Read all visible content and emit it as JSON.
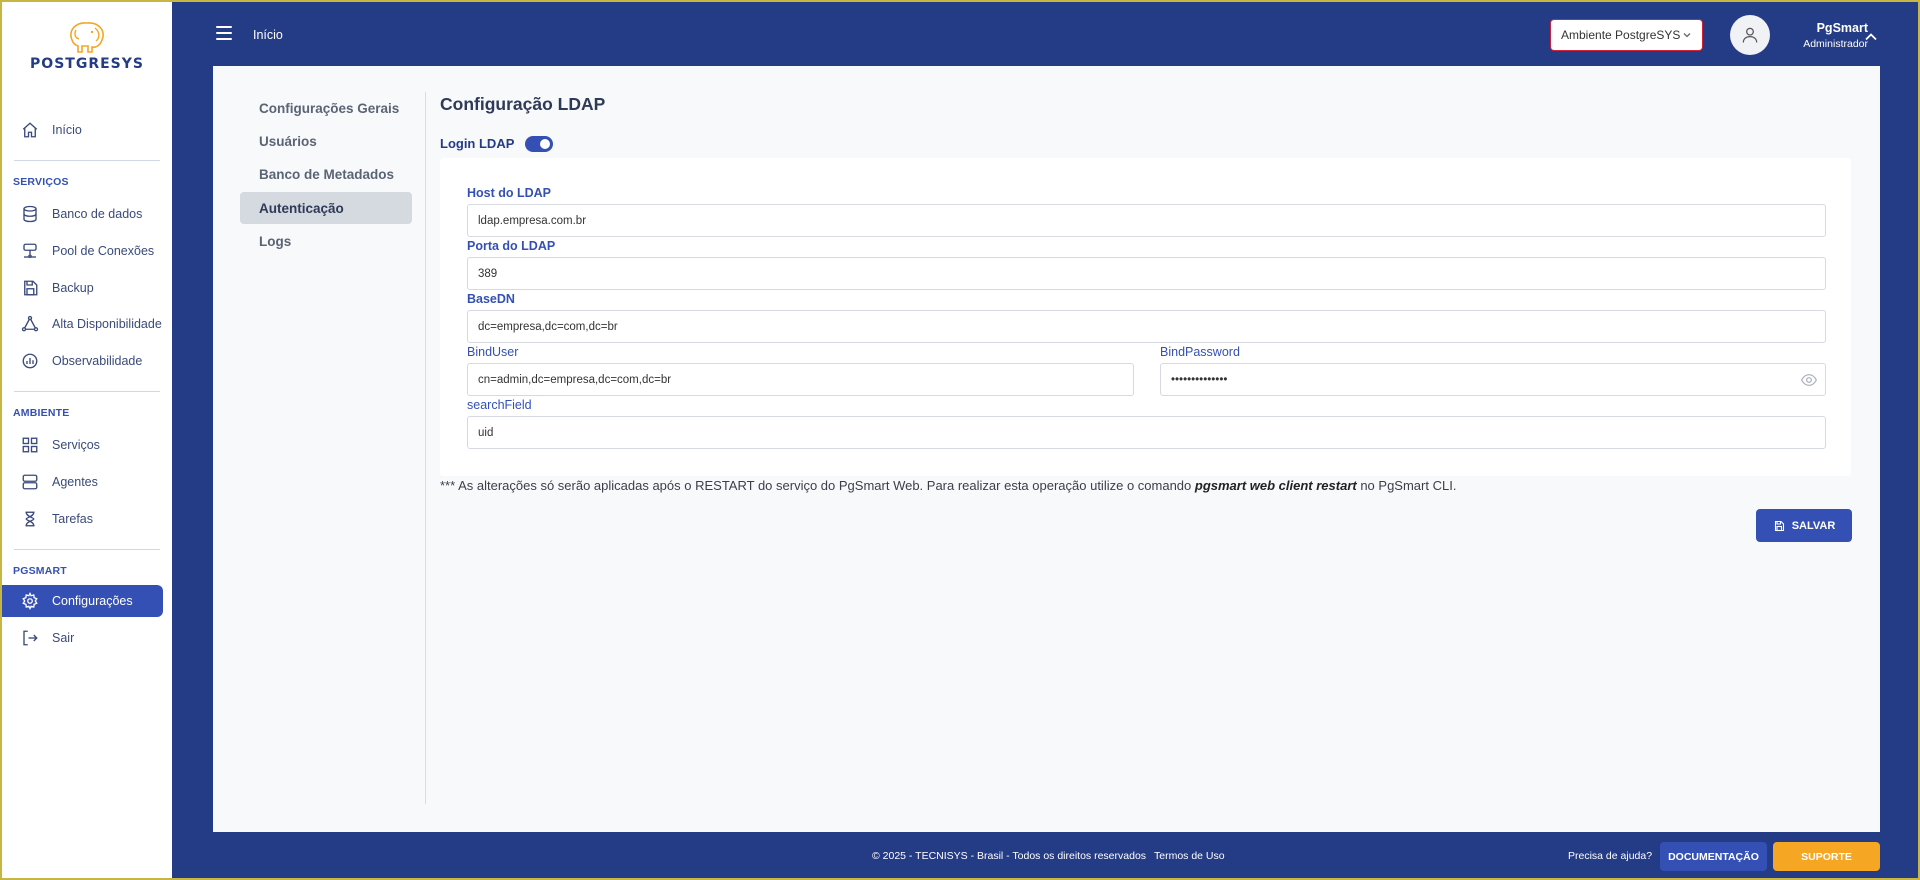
{
  "brand": {
    "name": "POSTGRESYS"
  },
  "sidebar": {
    "home": {
      "label": "Início",
      "icon": "home-icon"
    },
    "sections": [
      {
        "title": "SERVIÇOS"
      },
      {
        "title": "AMBIENTE"
      },
      {
        "title": "PGSMART"
      }
    ],
    "services": [
      {
        "label": "Banco de dados",
        "icon": "database-icon"
      },
      {
        "label": "Pool de Conexões",
        "icon": "connection-pool-icon"
      },
      {
        "label": "Backup",
        "icon": "save-icon"
      },
      {
        "label": "Alta Disponibilidade",
        "icon": "triangle-network-icon"
      },
      {
        "label": "Observabilidade",
        "icon": "chart-circle-icon"
      }
    ],
    "environment": [
      {
        "label": "Serviços",
        "icon": "grid-icon"
      },
      {
        "label": "Agentes",
        "icon": "server-icon"
      },
      {
        "label": "Tarefas",
        "icon": "hourglass-icon"
      }
    ],
    "pgsmart": [
      {
        "label": "Configurações",
        "icon": "gear-icon",
        "active": true
      },
      {
        "label": "Sair",
        "icon": "logout-icon"
      }
    ]
  },
  "topbar": {
    "breadcrumb": "Início",
    "environment_select": "Ambiente PostgreSYS",
    "user": {
      "name": "PgSmart",
      "role": "Administrador"
    }
  },
  "settings_nav": [
    {
      "label": "Configurações Gerais"
    },
    {
      "label": "Usuários"
    },
    {
      "label": "Banco de Metadados"
    },
    {
      "label": "Autenticação",
      "active": true
    },
    {
      "label": "Logs"
    }
  ],
  "ldap": {
    "title": "Configuração LDAP",
    "login_label": "Login LDAP",
    "login_enabled": true,
    "host_label": "Host do LDAP",
    "host_value": "ldap.empresa.com.br",
    "port_label": "Porta do LDAP",
    "port_value": "389",
    "basedn_label": "BaseDN",
    "basedn_value": "dc=empresa,dc=com,dc=br",
    "binduser_label": "BindUser",
    "binduser_value": "cn=admin,dc=empresa,dc=com,dc=br",
    "bindpassword_label": "BindPassword",
    "bindpassword_value": "••••••••••••••",
    "searchfield_label": "searchField",
    "searchfield_value": "uid",
    "notice_prefix": "*** As alterações só serão aplicadas após o RESTART do serviço do PgSmart Web. Para realizar esta operação utilize o comando ",
    "notice_command": "pgsmart web client restart",
    "notice_suffix": " no PgSmart CLI.",
    "save_label": "SALVAR"
  },
  "footer": {
    "copyright": "© 2025 - TECNISYS - Brasil - Todos os direitos reservados",
    "terms": "Termos de Uso",
    "help": "Precisa de ajuda?",
    "docs_button": "DOCUMENTAÇÃO",
    "support_button": "SUPORTE"
  },
  "colors": {
    "primary": "#243b85",
    "accent": "#3450b4",
    "support": "#f5a623",
    "logo": "#f5a623"
  }
}
